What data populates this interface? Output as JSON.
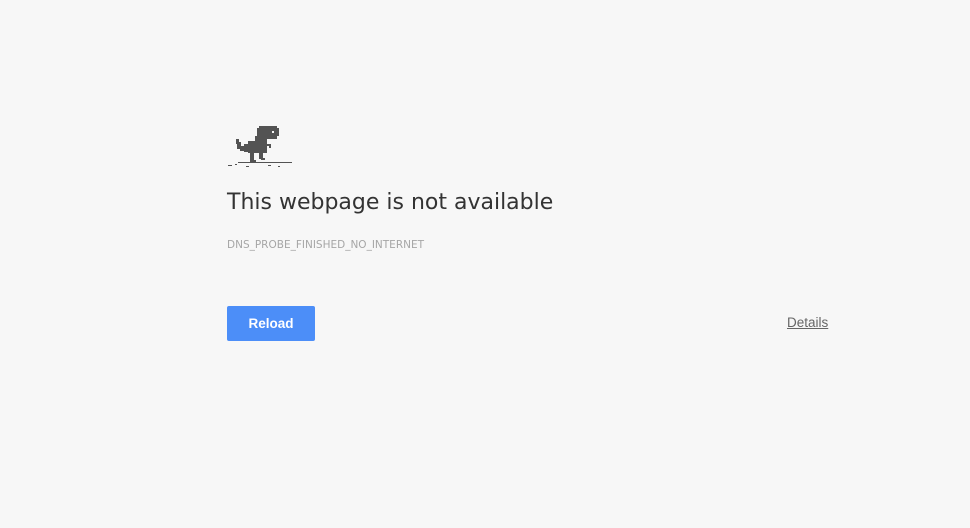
{
  "error_page": {
    "icon": "offline-dinosaur-icon",
    "title": "This webpage is not available",
    "error_code": "DNS_PROBE_FINISHED_NO_INTERNET",
    "reload_label": "Reload",
    "details_label": "Details"
  },
  "colors": {
    "background": "#f7f7f7",
    "title_text": "#333333",
    "error_code_text": "#a6a6a6",
    "reload_button": "#4c8ef8",
    "details_link": "#666666",
    "dino": "#535353"
  }
}
